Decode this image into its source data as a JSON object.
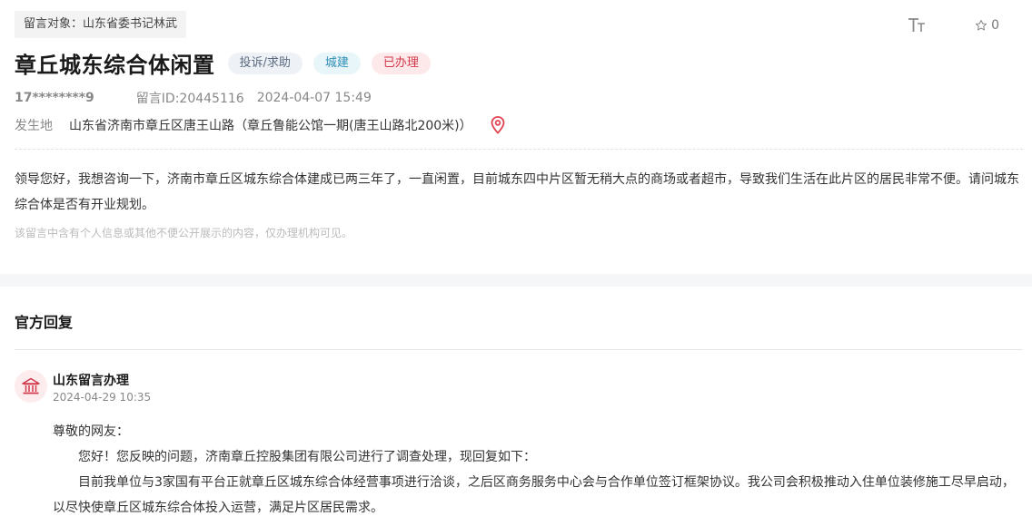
{
  "header": {
    "target_label": "留言对象：山东省委书记林武",
    "favorite_count": "0",
    "font_size_icon": "font-size-icon",
    "favorite_icon": "star-icon"
  },
  "message": {
    "title": "章丘城东综合体闲置",
    "tags": {
      "type": "投诉/求助",
      "category": "城建",
      "status": "已办理"
    },
    "user": "17********9",
    "id_text": "留言ID:20445116",
    "datetime": "2024-04-07 15:49",
    "location_label": "发生地",
    "location": "山东省济南市章丘区唐王山路（章丘鲁能公馆一期(唐王山路北200米)）",
    "content": "领导您好，我想咨询一下，济南市章丘区城东综合体建成已两三年了，一直闲置，目前城东四中片区暂无稍大点的商场或者超市，导致我们生活在此片区的居民非常不便。请问城东综合体是否有开业规划。",
    "privacy_note": "该留言中含有个人信息或其他不便公开展示的内容，仅办理机构可见。"
  },
  "reply": {
    "heading": "官方回复",
    "org_name": "山东留言办理",
    "time": "2024-04-29 10:35",
    "greeting": "尊敬的网友：",
    "paragraph1": "您好！您反映的问题，济南章丘控股集团有限公司进行了调查处理，现回复如下：",
    "paragraph2": "目前我单位与3家国有平台正就章丘区城东综合体经营事项进行洽谈，之后区商务服务中心会与合作单位签订框架协议。我公司会积极推动入住单位装修施工尽早启动，以尽快使章丘区城东综合体投入运营，满足片区居民需求。",
    "avatar_icon": "government-building-icon"
  },
  "colors": {
    "status_red": "#d2384a",
    "category_blue": "#2e8fb5",
    "pin_red": "#e0424f"
  }
}
